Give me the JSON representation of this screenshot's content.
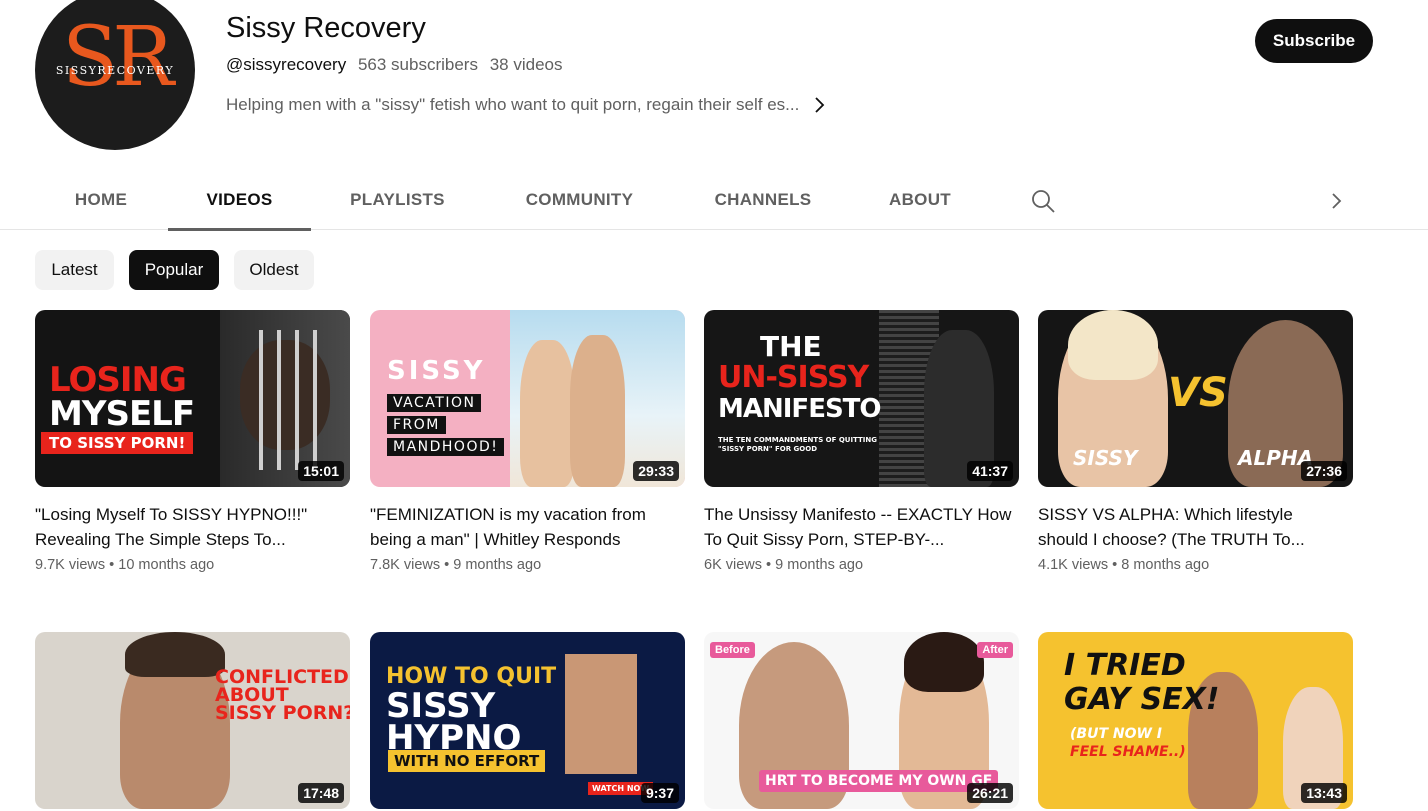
{
  "channel": {
    "avatar_text": "SR",
    "avatar_subtext": "SISSYRECOVERY",
    "name": "Sissy Recovery",
    "handle": "@sissyrecovery",
    "subscribers": "563 subscribers",
    "videos_count": "38 videos",
    "description": "Helping men with a \"sissy\" fetish who want to quit porn, regain their self es...",
    "subscribe_label": "Subscribe"
  },
  "tabs": [
    {
      "label": "HOME"
    },
    {
      "label": "VIDEOS"
    },
    {
      "label": "PLAYLISTS"
    },
    {
      "label": "COMMUNITY"
    },
    {
      "label": "CHANNELS"
    },
    {
      "label": "ABOUT"
    }
  ],
  "active_tab": "VIDEOS",
  "icons": {
    "search": "search-icon",
    "next": "chevron-right-icon",
    "description_more": "chevron-right-icon"
  },
  "filters": [
    {
      "label": "Latest"
    },
    {
      "label": "Popular"
    },
    {
      "label": "Oldest"
    }
  ],
  "active_filter": "Popular",
  "videos": [
    {
      "title": "\"Losing Myself To SISSY HYPNO!!!\" Revealing The Simple Steps To...",
      "views": "9.7K views",
      "age": "10 months ago",
      "duration": "15:01",
      "thumb": {
        "line1": "LOSING",
        "line2": "MYSELF",
        "line3": "TO SISSY PORN!"
      }
    },
    {
      "title": "\"FEMINIZATION is my vacation from being a man\" | Whitley Responds",
      "views": "7.8K views",
      "age": "9 months ago",
      "duration": "29:33",
      "thumb": {
        "line1": "SISSY",
        "line2": "VACATION",
        "line3": "FROM",
        "line4": "MANDHOOD!"
      }
    },
    {
      "title": "The Unsissy Manifesto -- EXACTLY How To Quit Sissy Porn, STEP-BY-...",
      "views": "6K views",
      "age": "9 months ago",
      "duration": "41:37",
      "thumb": {
        "line1": "THE",
        "line2": "UN-SISSY",
        "line3": "MANIFESTO",
        "line4": "THE TEN COMMANDMENTS OF QUITTING",
        "line5": "\"SISSY PORN\" FOR GOOD"
      }
    },
    {
      "title": "SISSY VS ALPHA: Which lifestyle should I choose? (The TRUTH To...",
      "views": "4.1K views",
      "age": "8 months ago",
      "duration": "27:36",
      "thumb": {
        "line1": "VS",
        "line2": "SISSY",
        "line3": "ALPHA"
      }
    },
    {
      "duration": "17:48",
      "thumb": {
        "line1": "CONFLICTED",
        "line2": "ABOUT",
        "line3": "SISSY PORN?!"
      }
    },
    {
      "duration": "9:37",
      "thumb": {
        "line1": "HOW TO QUIT",
        "line2": "SISSY",
        "line3": "HYPNO",
        "line4": "WITH NO EFFORT",
        "line5": "WATCH NOW"
      }
    },
    {
      "duration": "26:21",
      "thumb": {
        "line1": "Before",
        "line2": "After",
        "line3": "HRT TO BECOME MY OWN GF"
      }
    },
    {
      "duration": "13:43",
      "thumb": {
        "line1": "I TRIED",
        "line2": "GAY SEX!",
        "line3": "(BUT NOW I",
        "line4": "FEEL SHAME..)"
      }
    }
  ],
  "colors": {
    "accent_red": "#e8241c",
    "avatar_orange": "#e8581e",
    "pink": "#f2a3b8",
    "yellow": "#f5c22f",
    "navy": "#0b1a44"
  }
}
